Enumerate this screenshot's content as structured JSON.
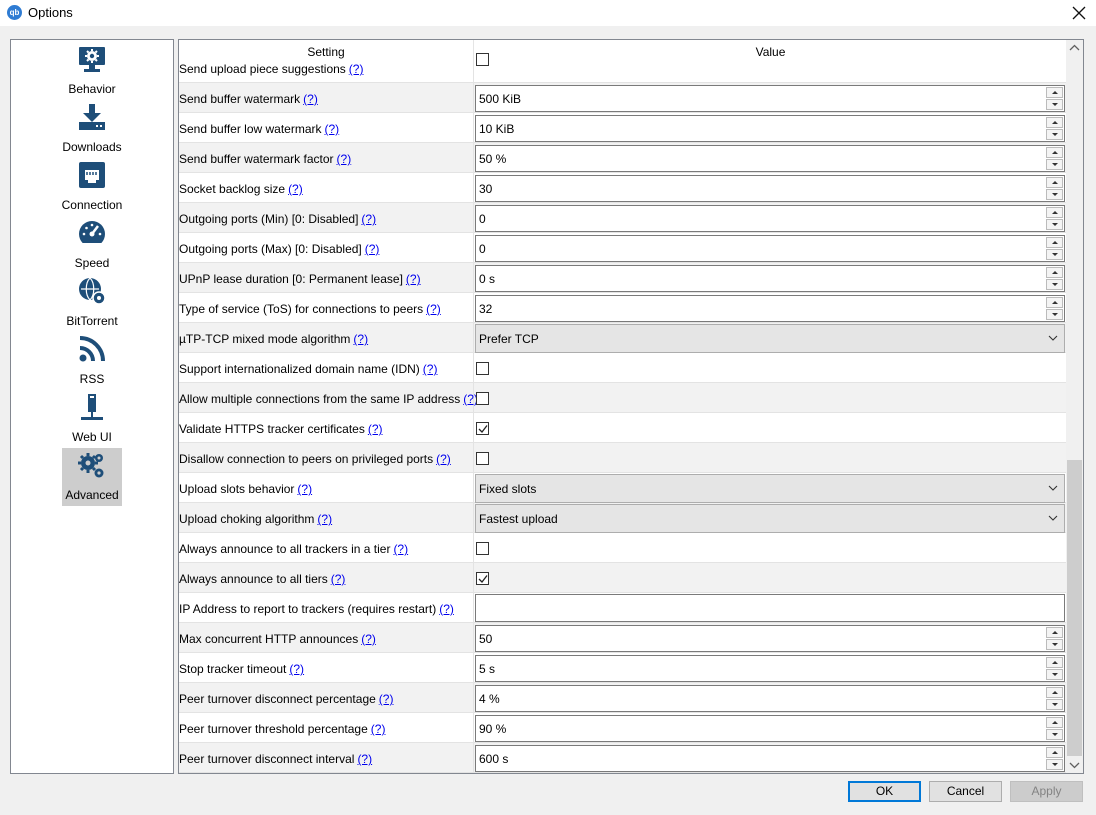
{
  "window": {
    "title": "Options",
    "app_icon": "qb"
  },
  "sidebar": {
    "items": [
      {
        "label": "Behavior",
        "icon": "monitor-gear-icon"
      },
      {
        "label": "Downloads",
        "icon": "download-tray-icon"
      },
      {
        "label": "Connection",
        "icon": "network-port-icon"
      },
      {
        "label": "Speed",
        "icon": "speedometer-icon"
      },
      {
        "label": "BitTorrent",
        "icon": "globe-gear-icon"
      },
      {
        "label": "RSS",
        "icon": "rss-icon"
      },
      {
        "label": "Web UI",
        "icon": "web-ui-icon"
      },
      {
        "label": "Advanced",
        "icon": "gears-icon",
        "selected": true
      }
    ]
  },
  "table": {
    "headers": {
      "setting": "Setting",
      "value": "Value"
    },
    "help_text": "(?)",
    "rows": [
      {
        "label": "Send upload piece suggestions",
        "type": "checkbox",
        "checked": false
      },
      {
        "label": "Send buffer watermark",
        "type": "spin",
        "value": "500 KiB"
      },
      {
        "label": "Send buffer low watermark",
        "type": "spin",
        "value": "10 KiB"
      },
      {
        "label": "Send buffer watermark factor",
        "type": "spin",
        "value": "50 %"
      },
      {
        "label": "Socket backlog size",
        "type": "spin",
        "value": "30"
      },
      {
        "label": "Outgoing ports (Min) [0: Disabled]",
        "type": "spin",
        "value": "0"
      },
      {
        "label": "Outgoing ports (Max) [0: Disabled]",
        "type": "spin",
        "value": "0"
      },
      {
        "label": "UPnP lease duration [0: Permanent lease]",
        "type": "spin",
        "value": "0 s"
      },
      {
        "label": "Type of service (ToS) for connections to peers",
        "type": "spin",
        "value": "32"
      },
      {
        "label": "µTP-TCP mixed mode algorithm",
        "type": "combo",
        "value": "Prefer TCP"
      },
      {
        "label": "Support internationalized domain name (IDN)",
        "type": "checkbox",
        "checked": false
      },
      {
        "label": "Allow multiple connections from the same IP address",
        "type": "checkbox",
        "checked": false
      },
      {
        "label": "Validate HTTPS tracker certificates",
        "type": "checkbox",
        "checked": true
      },
      {
        "label": "Disallow connection to peers on privileged ports",
        "type": "checkbox",
        "checked": false
      },
      {
        "label": "Upload slots behavior",
        "type": "combo",
        "value": "Fixed slots"
      },
      {
        "label": "Upload choking algorithm",
        "type": "combo",
        "value": "Fastest upload"
      },
      {
        "label": "Always announce to all trackers in a tier",
        "type": "checkbox",
        "checked": false
      },
      {
        "label": "Always announce to all tiers",
        "type": "checkbox",
        "checked": true
      },
      {
        "label": "IP Address to report to trackers (requires restart)",
        "type": "text",
        "value": ""
      },
      {
        "label": "Max concurrent HTTP announces",
        "type": "spin",
        "value": "50"
      },
      {
        "label": "Stop tracker timeout",
        "type": "spin",
        "value": "5 s"
      },
      {
        "label": "Peer turnover disconnect percentage",
        "type": "spin",
        "value": "4 %"
      },
      {
        "label": "Peer turnover threshold percentage",
        "type": "spin",
        "value": "90 %"
      },
      {
        "label": "Peer turnover disconnect interval",
        "type": "spin",
        "value": "600 s"
      }
    ]
  },
  "buttons": {
    "ok": "OK",
    "cancel": "Cancel",
    "apply": "Apply"
  },
  "colors": {
    "help_link": "#0000ee",
    "selected_nav": "#cdcdcd",
    "icon": "#1e4e79"
  }
}
